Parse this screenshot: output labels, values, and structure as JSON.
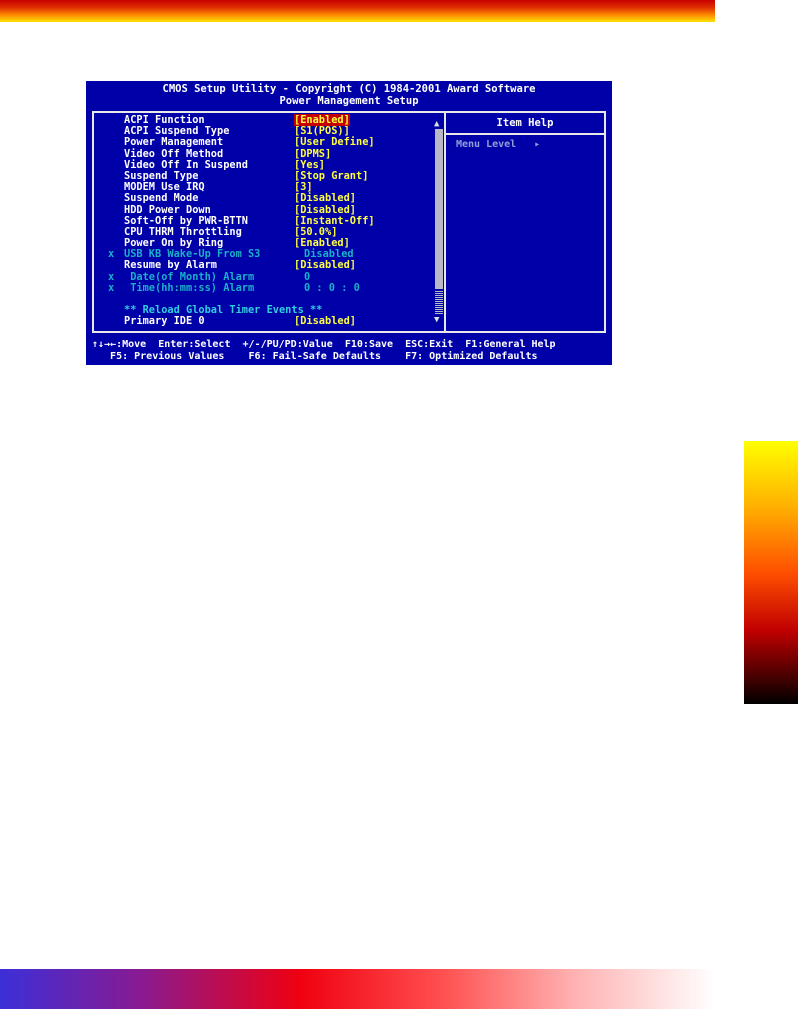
{
  "bios": {
    "title_line1": "CMOS Setup Utility - Copyright (C) 1984-2001 Award Software",
    "title_line2": "Power Management Setup",
    "settings": [
      {
        "label": "ACPI Function",
        "value": "[Enabled]",
        "highlighted": true
      },
      {
        "label": "ACPI Suspend Type",
        "value": "[S1(POS)]"
      },
      {
        "label": "Power Management",
        "value": "[User Define]"
      },
      {
        "label": "Video Off Method",
        "value": "[DPMS]"
      },
      {
        "label": "Video Off In Suspend",
        "value": "[Yes]"
      },
      {
        "label": "Suspend Type",
        "value": "[Stop Grant]"
      },
      {
        "label": "MODEM Use IRQ",
        "value": "[3]"
      },
      {
        "label": "Suspend Mode",
        "value": "[Disabled]"
      },
      {
        "label": "HDD Power Down",
        "value": "[Disabled]"
      },
      {
        "label": "Soft-Off by PWR-BTTN",
        "value": "[Instant-Off]"
      },
      {
        "label": "CPU THRM Throttling",
        "value": "[50.0%]"
      },
      {
        "label": "Power On by Ring",
        "value": "[Enabled]"
      },
      {
        "label": "USB KB Wake-Up From S3",
        "value": "Disabled",
        "disabled": true
      },
      {
        "label": "Resume by Alarm",
        "value": "[Disabled]"
      },
      {
        "label": " Date(of Month) Alarm",
        "value": "0",
        "disabled": true
      },
      {
        "label": " Time(hh:mm:ss) Alarm",
        "value": "0 : 0 : 0",
        "disabled": true
      },
      {
        "label": "",
        "value": ""
      },
      {
        "label": "** Reload Global Timer Events **",
        "value": "",
        "section": true
      },
      {
        "label": "Primary IDE 0",
        "value": "[Disabled]"
      }
    ],
    "disabled_marker": "x",
    "help": {
      "title": "Item Help",
      "menu_level": "Menu Level   ▸"
    },
    "footer_line1": "↑↓→←:Move  Enter:Select  +/-/PU/PD:Value  F10:Save  ESC:Exit  F1:General Help",
    "footer_line2": "   F5: Previous Values    F6: Fail-Safe Defaults    F7: Optimized Defaults",
    "scroll_up": "▲",
    "scroll_down": "▼"
  },
  "colors": {
    "bios_background": "#0000a8",
    "value_text": "#ffff40",
    "highlight": "#c40000",
    "disabled_text": "#1ab0c8"
  }
}
